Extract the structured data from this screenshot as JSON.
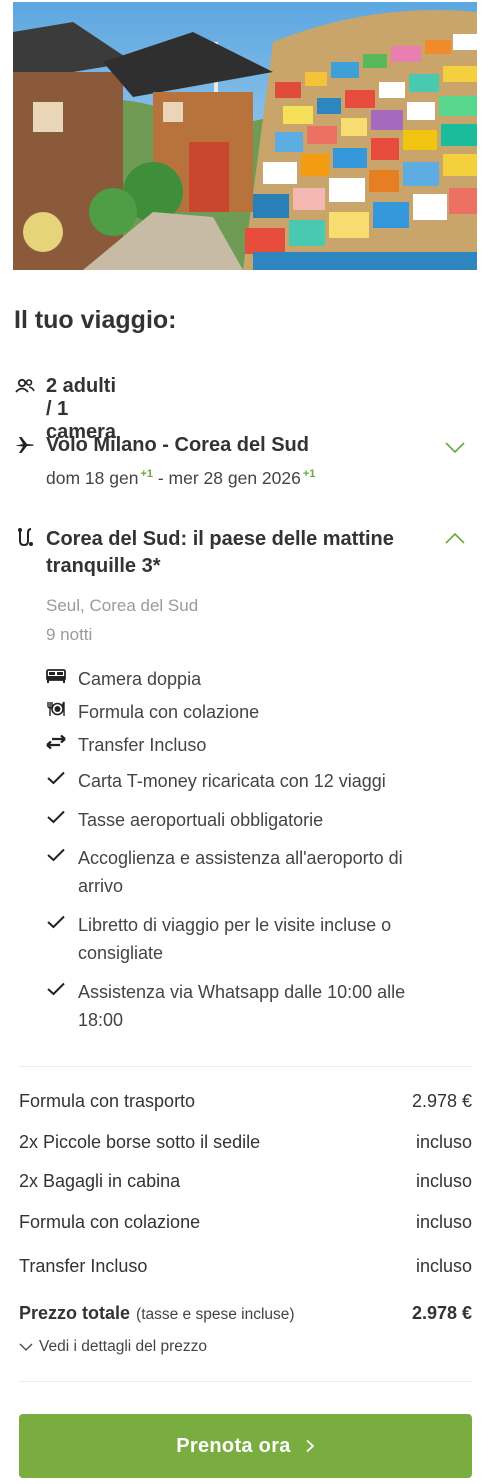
{
  "hero": {
    "image": "hero-korea-village-image"
  },
  "trip": {
    "heading": "Il tuo viaggio:",
    "travelers": "2 adulti / 1 camera",
    "flight": {
      "title": "Volo Milano - Corea del Sud",
      "depart": "dom 18 gen",
      "depart_plus": "+1",
      "separator": "- mer 28 gen 2026",
      "return_plus": "+1"
    },
    "hotel": {
      "title": "Corea del Sud: il paese delle mattine tranquille 3*",
      "location": "Seul, Corea del Sud",
      "nights": "9 notti"
    },
    "inclusions": [
      {
        "icon": "bed-icon",
        "label": "Camera doppia"
      },
      {
        "icon": "meal-icon",
        "label": "Formula con colazione"
      },
      {
        "icon": "transfer-icon",
        "label": "Transfer Incluso"
      },
      {
        "icon": "check-icon",
        "label": "Carta T-money ricaricata con 12 viaggi"
      },
      {
        "icon": "check-icon",
        "label": "Tasse aeroportuali obbligatorie"
      },
      {
        "icon": "check-icon",
        "label": "Accoglienza e assistenza all'aeroporto di arrivo"
      },
      {
        "icon": "check-icon",
        "label": "Libretto di viaggio per le visite incluse o consigliate"
      },
      {
        "icon": "check-icon",
        "label": "Assistenza via Whatsapp dalle 10:00 alle 18:00"
      }
    ]
  },
  "prices": [
    {
      "label": "Formula con trasporto",
      "value": "2.978 €"
    },
    {
      "label": "2x Piccole borse sotto il sedile",
      "value": "incluso"
    },
    {
      "label": "2x Bagagli in cabina",
      "value": "incluso"
    },
    {
      "label": "Formula con colazione",
      "value": "incluso"
    },
    {
      "label": "Transfer Incluso",
      "value": "incluso"
    }
  ],
  "total": {
    "label": "Prezzo totale",
    "note": "(tasse e spese incluse)",
    "amount": "2.978 €",
    "details_link": "Vedi i dettagli del prezzo"
  },
  "cta": {
    "label": "Prenota ora"
  },
  "colors": {
    "accent": "#79ad40",
    "chevron": "#6aa93a"
  }
}
